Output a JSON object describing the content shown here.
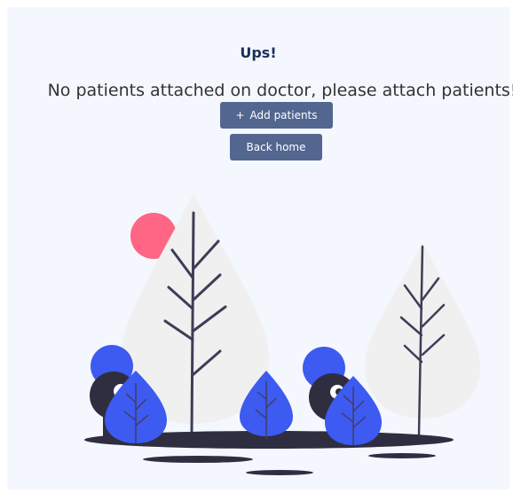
{
  "empty_state": {
    "title": "Ups!",
    "message": "No patients attached on doctor, please attach patients!",
    "add_button_icon": "+",
    "add_button_label": "Add patients",
    "back_button_label": "Back home"
  },
  "colors": {
    "background": "#f4f7fd",
    "title": "#1c2f5a",
    "button": "#536690",
    "accent_blue": "#3d5af1",
    "sun": "#ff6584",
    "tree_foliage": "#f0f0f0",
    "dark": "#3f3d56",
    "ground": "#2f2e41"
  },
  "illustration": {
    "name": "empty-state-illustration",
    "elements": [
      "sun",
      "large-tree",
      "small-tree",
      "person-left",
      "person-right",
      "bushes",
      "ground"
    ]
  }
}
